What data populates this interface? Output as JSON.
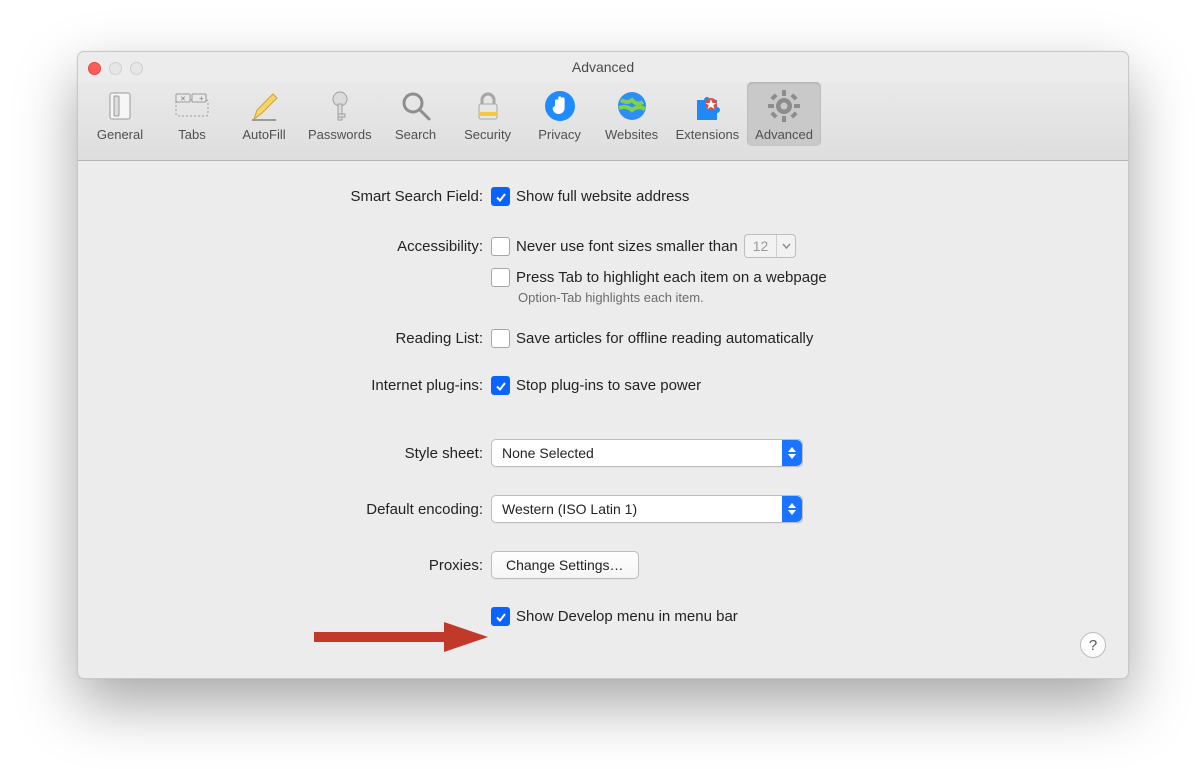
{
  "window": {
    "title": "Advanced"
  },
  "toolbar": {
    "items": [
      {
        "id": "general",
        "label": "General"
      },
      {
        "id": "tabs",
        "label": "Tabs"
      },
      {
        "id": "autofill",
        "label": "AutoFill"
      },
      {
        "id": "passwords",
        "label": "Passwords"
      },
      {
        "id": "search",
        "label": "Search"
      },
      {
        "id": "security",
        "label": "Security"
      },
      {
        "id": "privacy",
        "label": "Privacy"
      },
      {
        "id": "websites",
        "label": "Websites"
      },
      {
        "id": "extensions",
        "label": "Extensions"
      },
      {
        "id": "advanced",
        "label": "Advanced"
      }
    ],
    "selected": "advanced"
  },
  "labels": {
    "smart_search": "Smart Search Field:",
    "accessibility": "Accessibility:",
    "reading_list": "Reading List:",
    "plugins": "Internet plug-ins:",
    "style_sheet": "Style sheet:",
    "default_encoding": "Default encoding:",
    "proxies": "Proxies:"
  },
  "smart_search": {
    "show_full_url": {
      "checked": true,
      "label": "Show full website address"
    }
  },
  "accessibility": {
    "min_font": {
      "checked": false,
      "label": "Never use font sizes smaller than",
      "value": "12"
    },
    "press_tab": {
      "checked": false,
      "label": "Press Tab to highlight each item on a webpage"
    },
    "hint": "Option-Tab highlights each item."
  },
  "reading_list": {
    "offline": {
      "checked": false,
      "label": "Save articles for offline reading automatically"
    }
  },
  "plugins": {
    "stop": {
      "checked": true,
      "label": "Stop plug-ins to save power"
    }
  },
  "style_sheet": {
    "value": "None Selected"
  },
  "default_encoding": {
    "value": "Western (ISO Latin 1)"
  },
  "proxies": {
    "button": "Change Settings…"
  },
  "develop": {
    "checked": true,
    "label": "Show Develop menu in menu bar"
  },
  "help_tooltip": "?"
}
